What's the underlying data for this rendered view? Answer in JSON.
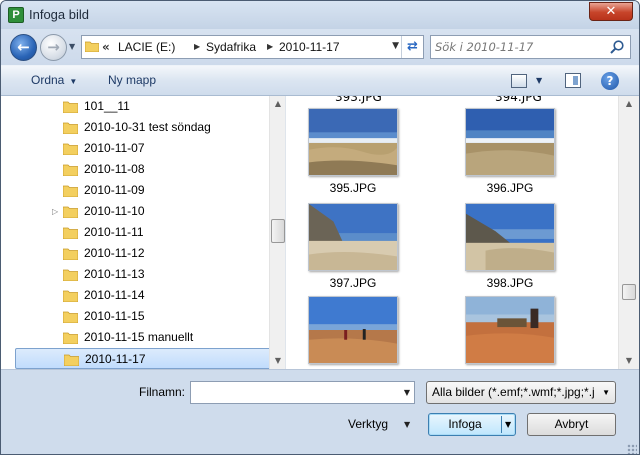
{
  "window": {
    "title": "Infoga bild",
    "app_icon_letter": "P",
    "close_glyph": "✕"
  },
  "address": {
    "overflow": "«",
    "crumbs": [
      "LACIE (E:)",
      "Sydafrika",
      "2010-11-17"
    ]
  },
  "search": {
    "placeholder": "Sök i 2010-11-17"
  },
  "toolbar": {
    "organize_label": "Ordna",
    "new_folder_label": "Ny mapp",
    "help_glyph": "?"
  },
  "nav_tree": {
    "items": [
      {
        "label": "101__11"
      },
      {
        "label": "2010-10-31 test söndag"
      },
      {
        "label": "2010-11-07"
      },
      {
        "label": "2010-11-08"
      },
      {
        "label": "2010-11-09"
      },
      {
        "label": "2010-11-10"
      },
      {
        "label": "2010-11-11"
      },
      {
        "label": "2010-11-12"
      },
      {
        "label": "2010-11-13"
      },
      {
        "label": "2010-11-14"
      },
      {
        "label": "2010-11-15"
      },
      {
        "label": "2010-11-15 manuellt"
      },
      {
        "label": "2010-11-17"
      }
    ],
    "selected_index": 12
  },
  "files": {
    "items": [
      {
        "name": "395.JPG"
      },
      {
        "name": "396.JPG"
      },
      {
        "name": "397.JPG"
      },
      {
        "name": "398.JPG"
      }
    ]
  },
  "bottom": {
    "filename_label": "Filnamn:",
    "filename_value": "",
    "filetype_value": "Alla bilder (*.emf;*.wmf;*.jpg;*.j",
    "tools_label": "Verktyg",
    "insert_label": "Infoga",
    "cancel_label": "Avbryt"
  },
  "colors": {
    "chrome": "#cfdcec",
    "selection": "#c1dcfc",
    "close_red": "#c7442a",
    "folder_yellow": "#f3cf5f"
  }
}
